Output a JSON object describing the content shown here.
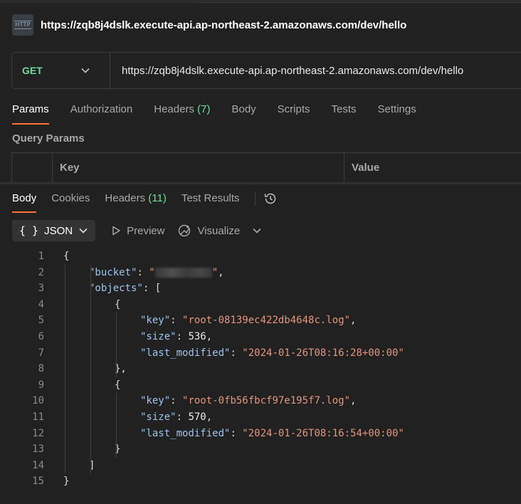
{
  "request": {
    "title": "https://zqb8j4dslk.execute-api.ap-northeast-2.amazonaws.com/dev/hello",
    "icon_label": "HTTP",
    "method": "GET",
    "url": "https://zqb8j4dslk.execute-api.ap-northeast-2.amazonaws.com/dev/hello"
  },
  "request_tabs": [
    {
      "label": "Params",
      "count": "",
      "active": true
    },
    {
      "label": "Authorization",
      "count": "",
      "active": false
    },
    {
      "label": "Headers",
      "count": "(7)",
      "active": false
    },
    {
      "label": "Body",
      "count": "",
      "active": false
    },
    {
      "label": "Scripts",
      "count": "",
      "active": false
    },
    {
      "label": "Tests",
      "count": "",
      "active": false
    },
    {
      "label": "Settings",
      "count": "",
      "active": false
    }
  ],
  "query_params": {
    "label": "Query Params",
    "columns": [
      "Key",
      "Value"
    ]
  },
  "response_tabs": [
    {
      "label": "Body",
      "count": "",
      "active": true
    },
    {
      "label": "Cookies",
      "count": "",
      "active": false
    },
    {
      "label": "Headers",
      "count": "(11)",
      "active": false
    },
    {
      "label": "Test Results",
      "count": "",
      "active": false
    }
  ],
  "response_toolbar": {
    "format_braces": "{ }",
    "format": "JSON",
    "preview": "Preview",
    "visualize": "Visualize"
  },
  "colors": {
    "accent": "#ff6c37",
    "method_get": "#6bdd9a",
    "json_key": "#9cc3ef",
    "json_string": "#e6947a"
  },
  "icons": [
    "http-icon",
    "chevron-down-icon",
    "history-icon",
    "play-icon",
    "visualize-icon"
  ],
  "response_body": {
    "lines": [
      [
        {
          "t": "p",
          "v": "{"
        }
      ],
      [
        {
          "t": "k",
          "v": "\"bucket\""
        },
        {
          "t": "p",
          "v": ": "
        },
        {
          "t": "s",
          "v": "\""
        },
        {
          "t": "blur",
          "v": ""
        },
        {
          "t": "s",
          "v": "\""
        },
        {
          "t": "p",
          "v": ","
        }
      ],
      [
        {
          "t": "k",
          "v": "\"objects\""
        },
        {
          "t": "p",
          "v": ": ["
        }
      ],
      [
        {
          "t": "p",
          "v": "{"
        }
      ],
      [
        {
          "t": "k",
          "v": "\"key\""
        },
        {
          "t": "p",
          "v": ": "
        },
        {
          "t": "s",
          "v": "\"root-08139ec422db4648c.log\""
        },
        {
          "t": "p",
          "v": ","
        }
      ],
      [
        {
          "t": "k",
          "v": "\"size\""
        },
        {
          "t": "p",
          "v": ": "
        },
        {
          "t": "n",
          "v": "536"
        },
        {
          "t": "p",
          "v": ","
        }
      ],
      [
        {
          "t": "k",
          "v": "\"last_modified\""
        },
        {
          "t": "p",
          "v": ": "
        },
        {
          "t": "s",
          "v": "\"2024-01-26T08:16:28+00:00\""
        }
      ],
      [
        {
          "t": "p",
          "v": "},"
        }
      ],
      [
        {
          "t": "p",
          "v": "{"
        }
      ],
      [
        {
          "t": "k",
          "v": "\"key\""
        },
        {
          "t": "p",
          "v": ": "
        },
        {
          "t": "s",
          "v": "\"root-0fb56fbcf97e195f7.log\""
        },
        {
          "t": "p",
          "v": ","
        }
      ],
      [
        {
          "t": "k",
          "v": "\"size\""
        },
        {
          "t": "p",
          "v": ": "
        },
        {
          "t": "n",
          "v": "570"
        },
        {
          "t": "p",
          "v": ","
        }
      ],
      [
        {
          "t": "k",
          "v": "\"last_modified\""
        },
        {
          "t": "p",
          "v": ": "
        },
        {
          "t": "s",
          "v": "\"2024-01-26T08:16:54+00:00\""
        }
      ],
      [
        {
          "t": "p",
          "v": "}"
        }
      ],
      [
        {
          "t": "p",
          "v": "]"
        }
      ],
      [
        {
          "t": "p",
          "v": "}"
        }
      ]
    ],
    "indent": [
      0,
      1,
      1,
      2,
      3,
      3,
      3,
      2,
      2,
      3,
      3,
      3,
      2,
      1,
      0
    ]
  }
}
